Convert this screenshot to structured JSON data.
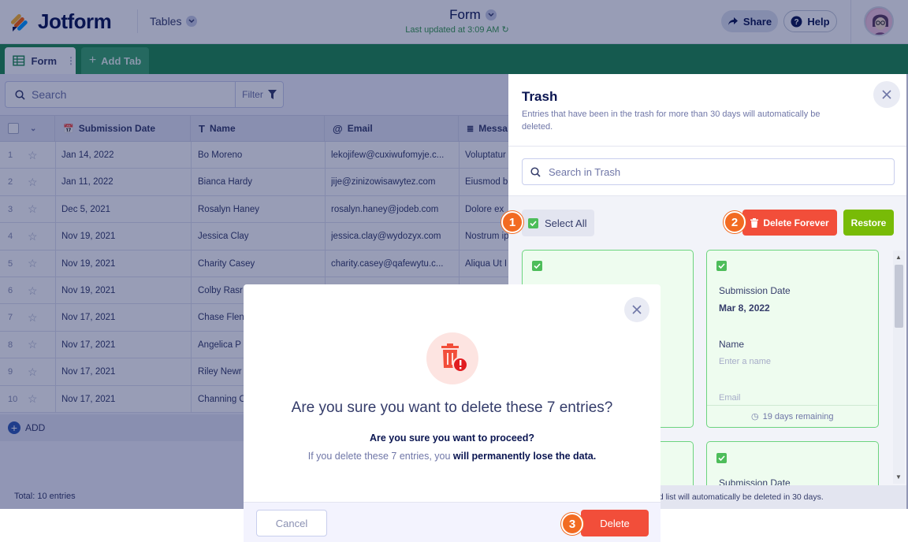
{
  "header": {
    "logo_text": "Jotform",
    "tables_label": "Tables",
    "form_title": "Form",
    "last_updated": "Last updated at 3:09 AM",
    "share_label": "Share",
    "help_label": "Help"
  },
  "tabs": {
    "form_label": "Form",
    "add_tab_label": "Add Tab"
  },
  "toolbar": {
    "search_placeholder": "Search",
    "filter_label": "Filter"
  },
  "grid": {
    "columns": [
      "Submission Date",
      "Name",
      "Email",
      "Messa"
    ],
    "rows": [
      {
        "num": "1",
        "date": "Jan 14, 2022",
        "name": "Bo Moreno",
        "email": "lekojifew@cuxiwufomyje.c...",
        "msg": "Voluptatur"
      },
      {
        "num": "2",
        "date": "Jan 11, 2022",
        "name": "Bianca Hardy",
        "email": "jije@zinizowisawytez.com",
        "msg": "Eiusmod b"
      },
      {
        "num": "3",
        "date": "Dec 5, 2021",
        "name": "Rosalyn Haney",
        "email": "rosalyn.haney@jodeb.com",
        "msg": "Dolore ex"
      },
      {
        "num": "4",
        "date": "Nov 19, 2021",
        "name": "Jessica Clay",
        "email": "jessica.clay@wydozyx.com",
        "msg": "Nostrum ip"
      },
      {
        "num": "5",
        "date": "Nov 19, 2021",
        "name": "Charity Casey",
        "email": "charity.casey@qafewytu.c...",
        "msg": "Aliqua Ut I"
      },
      {
        "num": "6",
        "date": "Nov 19, 2021",
        "name": "Colby Rasr",
        "email": "",
        "msg": ""
      },
      {
        "num": "7",
        "date": "Nov 17, 2021",
        "name": "Chase Flen",
        "email": "",
        "msg": ""
      },
      {
        "num": "8",
        "date": "Nov 17, 2021",
        "name": "Angelica P",
        "email": "",
        "msg": ""
      },
      {
        "num": "9",
        "date": "Nov 17, 2021",
        "name": "Riley Newr",
        "email": "",
        "msg": ""
      },
      {
        "num": "10",
        "date": "Nov 17, 2021",
        "name": "Channing C",
        "email": "",
        "msg": ""
      }
    ],
    "add_label": "ADD",
    "total_label": "Total: 10 entries"
  },
  "trash": {
    "title": "Trash",
    "description": "Entries that have been in the trash for more than 30 days will automatically be deleted.",
    "search_placeholder": "Search in Trash",
    "select_all_label": "Select All",
    "delete_forever_label": "Delete Forever",
    "restore_label": "Restore",
    "card": {
      "date_label": "Submission Date",
      "date_value": "Mar 8, 2022",
      "name_label": "Name",
      "name_placeholder": "Enter a name",
      "email_label": "Email",
      "remaining": "19 days remaining"
    },
    "card2_date_label": "Submission Date",
    "footnote": "ed list will automatically be deleted in 30 days."
  },
  "steps": [
    "1",
    "2",
    "3"
  ],
  "modal": {
    "title": "Are you sure you want to delete these 7 entries?",
    "question": "Are you sure you want to proceed?",
    "warn_prefix": "If you delete these 7 entries, you",
    "warn_bold": "will permanently lose the data.",
    "cancel_label": "Cancel",
    "delete_label": "Delete"
  },
  "colors": {
    "brand_green": "#1e8c4f",
    "danger": "#f24e3a",
    "restore": "#78bb07",
    "step_marker": "#f26b22"
  }
}
